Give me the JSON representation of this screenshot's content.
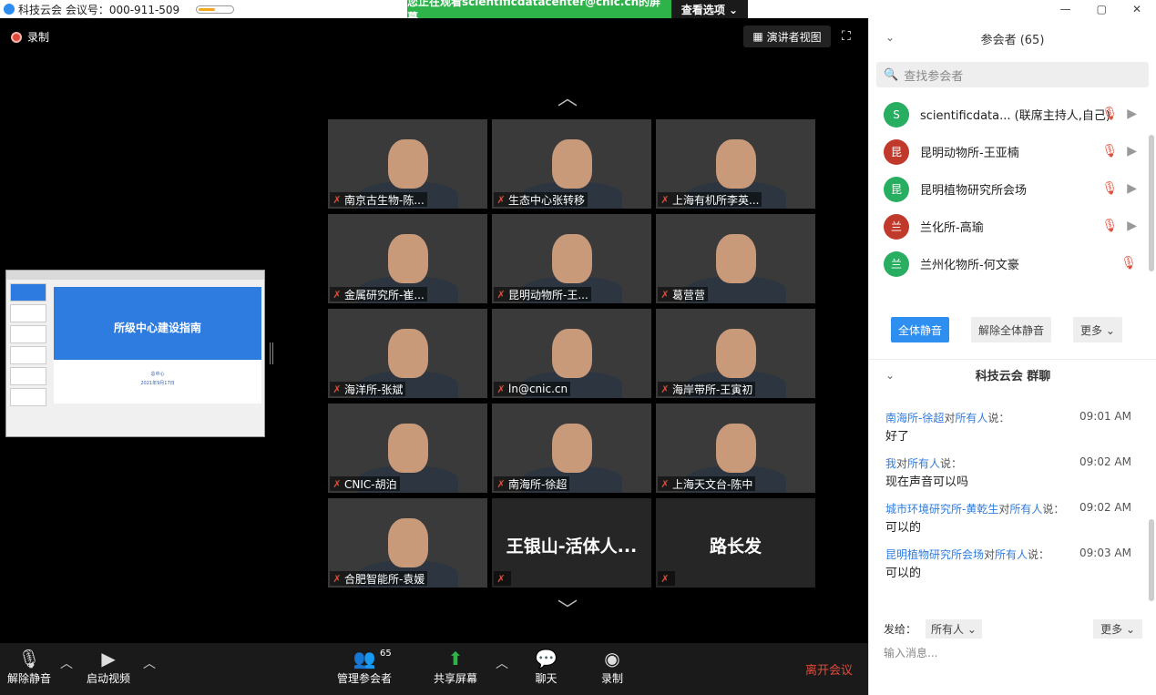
{
  "window": {
    "title": "科技云会 会议号：000-911-509",
    "share_banner": "您正在观看scientificdatacenter@cnic.cn的屏幕",
    "view_options": "查看选项 ⌄",
    "minimize": "—",
    "restore": "▢",
    "close": "✕"
  },
  "main": {
    "recording_label": "录制",
    "speaker_view": "演讲者视图",
    "slide": {
      "title": "所级中心建设指南",
      "subtitle": "总中心",
      "date": "2021年9月17日"
    }
  },
  "gallery": [
    {
      "name": "南京古生物-陈...",
      "type": "video"
    },
    {
      "name": "生态中心张转移",
      "type": "video"
    },
    {
      "name": "上海有机所李英...",
      "type": "video"
    },
    {
      "name": "金属研究所-崔...",
      "type": "video"
    },
    {
      "name": "昆明动物所-王...",
      "type": "video"
    },
    {
      "name": "葛营营",
      "type": "video"
    },
    {
      "name": "海洋所-张斌",
      "type": "video"
    },
    {
      "name": "ln@cnic.cn",
      "type": "video"
    },
    {
      "name": "海岸带所-王寅初",
      "type": "video"
    },
    {
      "name": "CNIC-胡泊",
      "type": "video"
    },
    {
      "name": "南海所-徐超",
      "type": "video"
    },
    {
      "name": "上海天文台-陈中",
      "type": "video"
    },
    {
      "name": "合肥智能所-袁媛",
      "type": "video"
    },
    {
      "name": "王银山-活体人...",
      "type": "blank"
    },
    {
      "name": "路长发",
      "type": "blank"
    }
  ],
  "toolbar": {
    "unmute": "解除静音",
    "start_video": "启动视频",
    "manage_participants": "管理参会者",
    "participant_count": "65",
    "share_screen": "共享屏幕",
    "chat": "聊天",
    "record": "录制",
    "leave": "离开会议"
  },
  "panel": {
    "title": "参会者 (65)",
    "search_placeholder": "查找参会者",
    "participants": [
      {
        "initial": "S",
        "name": "scientificdata... (联席主持人,自己)",
        "color": "#27ae60"
      },
      {
        "initial": "昆",
        "name": "昆明动物所-王亚楠",
        "color": "#c0392b"
      },
      {
        "initial": "昆",
        "name": "昆明植物研究所会场",
        "color": "#27ae60"
      },
      {
        "initial": "兰",
        "name": "兰化所-高瑜",
        "color": "#c0392b"
      },
      {
        "initial": "兰",
        "name": "兰州化物所-何文豪",
        "color": "#27ae60"
      }
    ],
    "mute_all": "全体静音",
    "unmute_all": "解除全体静音",
    "more": "更多 ⌄"
  },
  "chat": {
    "title": "科技云会 群聊",
    "messages": [
      {
        "sender": "南海所-徐超",
        "to_word": "对",
        "to": "所有人",
        "said": "说：",
        "time": "09:01 AM",
        "text": "好了"
      },
      {
        "sender": "我",
        "to_word": "对",
        "to": "所有人",
        "said": "说：",
        "time": "09:02 AM",
        "text": "现在声音可以吗"
      },
      {
        "sender": "城市环境研究所-黄乾生",
        "to_word": "对",
        "to": "所有人",
        "said": "说：",
        "time": "09:02 AM",
        "text": "可以的"
      },
      {
        "sender": "昆明植物研究所会场",
        "to_word": "对",
        "to": "所有人",
        "said": "说：",
        "time": "09:03 AM",
        "text": "可以的"
      }
    ],
    "send_to_label": "发给：",
    "send_to_value": "所有人 ⌄",
    "more": "更多 ⌄",
    "input_placeholder": "输入消息..."
  }
}
